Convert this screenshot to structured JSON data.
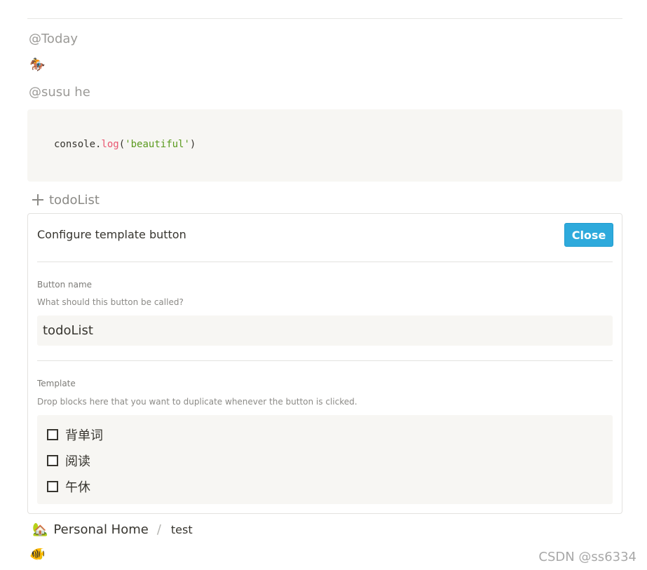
{
  "mentions": {
    "today": "@Today",
    "user": "@susu he"
  },
  "emojis": {
    "horse": "🏇",
    "fish": "🐠",
    "home": "🏡"
  },
  "code_block": {
    "object": "console",
    "dot": ".",
    "method": "log",
    "open": "(",
    "argument": "'beautiful'",
    "close": ")"
  },
  "template_button": {
    "icon": "plus-icon",
    "label": "todoList"
  },
  "config_panel": {
    "title": "Configure template button",
    "close_label": "Close",
    "name_field": {
      "label": "Button name",
      "hint": "What should this button be called?",
      "value": "todoList"
    },
    "template_field": {
      "label": "Template",
      "hint": "Drop blocks here that you want to duplicate whenever the button is clicked.",
      "items": [
        {
          "label": "背单词",
          "checked": false
        },
        {
          "label": "阅读",
          "checked": false
        },
        {
          "label": "午休",
          "checked": false
        }
      ]
    }
  },
  "breadcrumb": {
    "home": "Personal Home",
    "separator": "/",
    "current": "test"
  },
  "watermark": "CSDN @ss6334",
  "colors": {
    "accent": "#2eaadc",
    "code_background": "#f7f6f3",
    "code_method": "#e9556f",
    "code_string": "#5a9a1e",
    "muted_text": "#9b9a97"
  }
}
